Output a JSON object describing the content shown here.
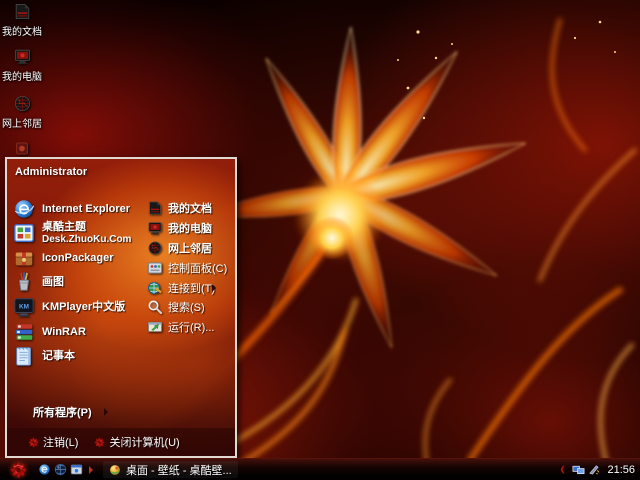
{
  "desktop": {
    "icons": [
      {
        "label": "我的文档",
        "icon": "my-documents-icon"
      },
      {
        "label": "我的电脑",
        "icon": "my-computer-icon"
      },
      {
        "label": "网上邻居",
        "icon": "network-places-icon"
      },
      {
        "label": "",
        "icon": "partial-hidden-icon"
      }
    ]
  },
  "start_menu": {
    "user_name": "Administrator",
    "left_items": [
      {
        "label": "Internet Explorer",
        "icon": "internet-explorer-icon"
      },
      {
        "label": "桌酷主题",
        "sublabel": "Desk.ZhuoKu.Com",
        "icon": "zhuoku-theme-icon"
      },
      {
        "label": "IconPackager",
        "icon": "iconpackager-icon"
      },
      {
        "label": "画图",
        "icon": "paint-icon"
      },
      {
        "label": "KMPlayer中文版",
        "icon": "kmplayer-icon"
      },
      {
        "label": "WinRAR",
        "icon": "winrar-icon"
      },
      {
        "label": "记事本",
        "icon": "notepad-icon"
      }
    ],
    "right_items": [
      {
        "label": "我的文档",
        "icon": "my-documents-icon",
        "bold": true
      },
      {
        "label": "我的电脑",
        "icon": "my-computer-icon",
        "bold": true
      },
      {
        "label": "网上邻居",
        "icon": "network-places-icon",
        "bold": true
      },
      {
        "label": "控制面板(C)",
        "icon": "control-panel-icon"
      },
      {
        "label": "连接到(T)",
        "icon": "connect-to-icon",
        "has_submenu": true
      },
      {
        "label": "搜索(S)",
        "icon": "search-icon"
      },
      {
        "label": "运行(R)...",
        "icon": "run-icon"
      }
    ],
    "all_programs": "所有程序(P)",
    "log_off": "注销(L)",
    "shut_down": "关闭计算机(U)"
  },
  "taskbar": {
    "start_button_icon": "red-flower-start-icon",
    "quick_launch_icons": [
      "internet-explorer-icon",
      "globe-icon",
      "web-window-icon"
    ],
    "task_button": {
      "label": "桌面 - 壁纸 - 桌酷壁...",
      "icon": "wallpaper-app-icon"
    },
    "tray": {
      "time": "21:56",
      "icons": [
        "network-connection-icon",
        "tray-utility-icon"
      ]
    }
  },
  "colors": {
    "accent_red": "#c41210",
    "menu_border": "#dfd9d2",
    "fire_orange": "#ff7a00",
    "taskbar_bg": "#020000"
  }
}
